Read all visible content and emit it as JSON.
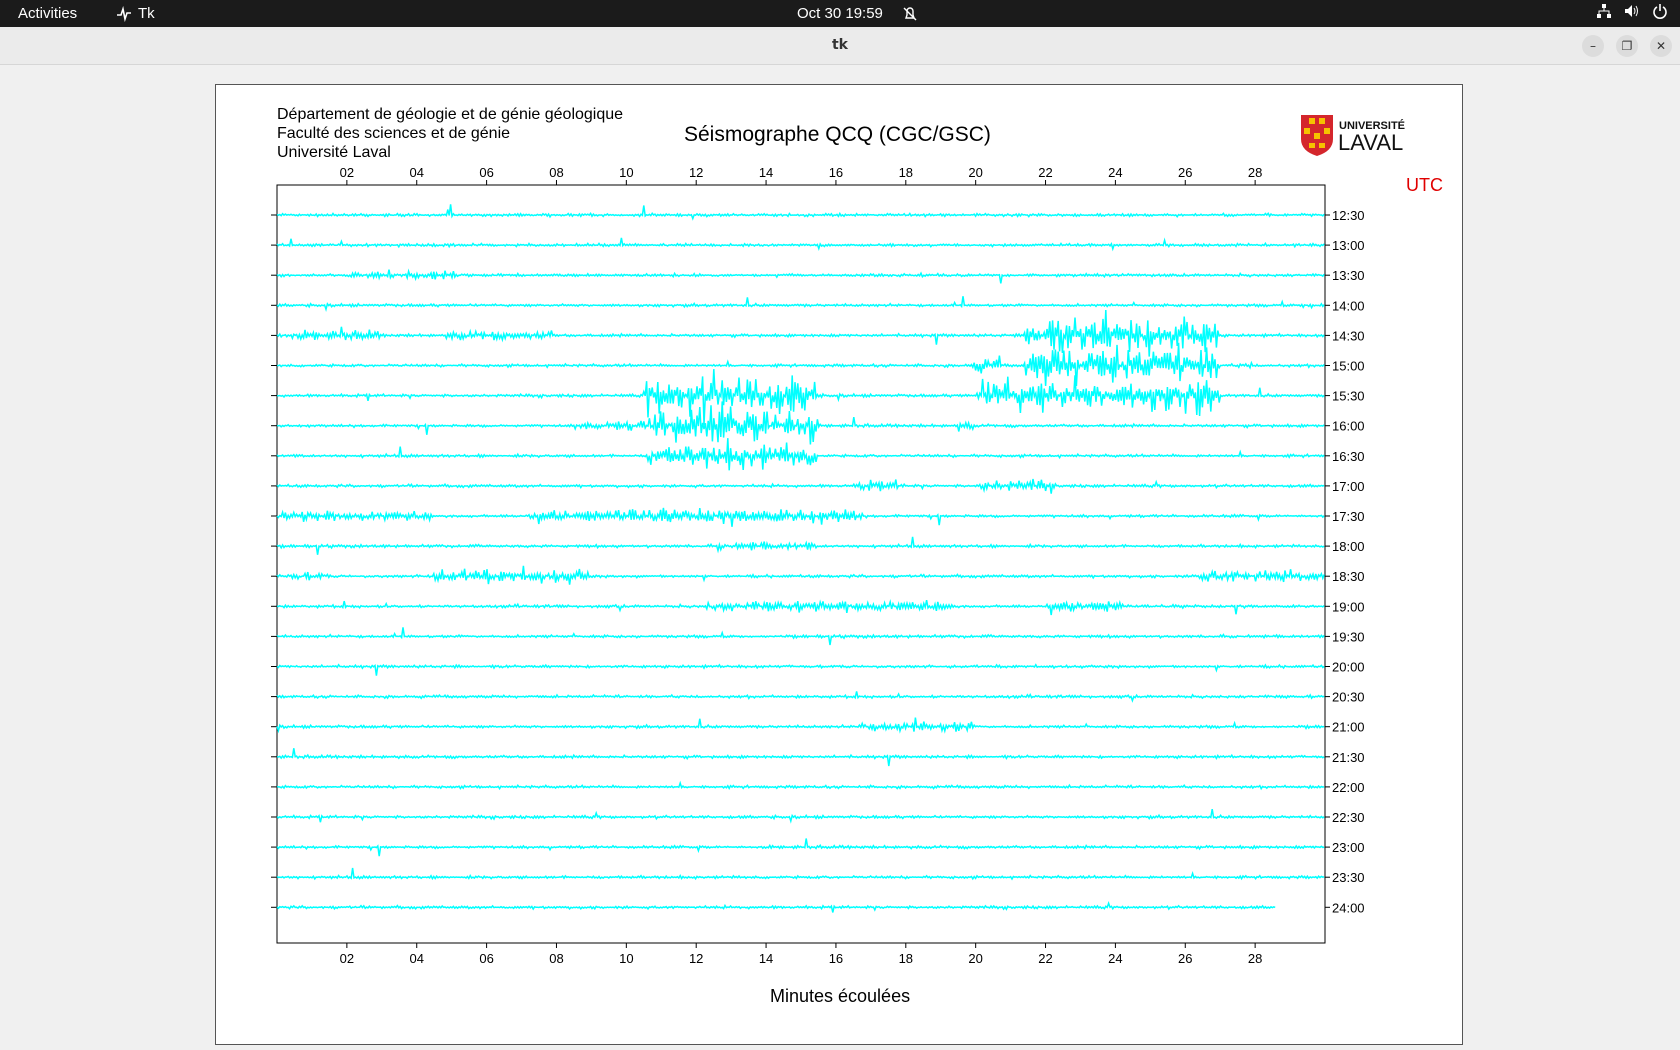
{
  "topbar": {
    "activities": "Activities",
    "app_name": "Tk",
    "datetime": "Oct 30  19:59"
  },
  "window": {
    "title": "tk"
  },
  "seismogram": {
    "header_lines": [
      "Département de géologie et de génie géologique",
      "Faculté des sciences et de génie",
      "Université Laval"
    ],
    "title": "Séismographe QCQ (CGC/GSC)",
    "logo_text": [
      "UNIVERSITÉ",
      "LAVAL"
    ],
    "timezone_label": "UTC",
    "xlabel": "Minutes écoulées",
    "colors": {
      "trace": "#00ffff",
      "utc_label": "#e00000",
      "axes": "#000000"
    }
  },
  "chart_data": {
    "type": "line",
    "x_range_minutes": [
      0,
      30
    ],
    "x_ticks": [
      "02",
      "04",
      "06",
      "08",
      "10",
      "12",
      "14",
      "16",
      "18",
      "20",
      "22",
      "24",
      "26",
      "28"
    ],
    "y_labels": [
      "12:30",
      "13:00",
      "13:30",
      "14:00",
      "14:30",
      "15:00",
      "15:30",
      "16:00",
      "16:30",
      "17:00",
      "17:30",
      "18:00",
      "18:30",
      "19:00",
      "19:30",
      "20:00",
      "20:30",
      "21:00",
      "21:30",
      "22:00",
      "22:30",
      "23:00",
      "23:30",
      "24:00"
    ],
    "trace_color": "#00ffff",
    "activity_bursts": [
      {
        "row": "13:30",
        "start_min": 1.9,
        "end_min": 5.2,
        "amplitude": 0.35
      },
      {
        "row": "14:00",
        "start_min": 29.3,
        "end_min": 30.0,
        "amplitude": 0.3
      },
      {
        "row": "14:30",
        "start_min": 0.0,
        "end_min": 3.0,
        "amplitude": 0.35
      },
      {
        "row": "14:30",
        "start_min": 4.8,
        "end_min": 8.0,
        "amplitude": 0.35
      },
      {
        "row": "14:30",
        "start_min": 21.4,
        "end_min": 27.0,
        "amplitude": 1.6
      },
      {
        "row": "15:00",
        "start_min": 19.8,
        "end_min": 20.8,
        "amplitude": 0.6
      },
      {
        "row": "15:00",
        "start_min": 21.4,
        "end_min": 27.0,
        "amplitude": 1.6
      },
      {
        "row": "15:00",
        "start_min": 27.5,
        "end_min": 28.0,
        "amplitude": 0.3
      },
      {
        "row": "15:30",
        "start_min": 10.5,
        "end_min": 15.5,
        "amplitude": 1.6
      },
      {
        "row": "15:30",
        "start_min": 20.0,
        "end_min": 27.0,
        "amplitude": 1.4
      },
      {
        "row": "16:00",
        "start_min": 8.5,
        "end_min": 10.6,
        "amplitude": 0.4
      },
      {
        "row": "16:00",
        "start_min": 10.6,
        "end_min": 15.5,
        "amplitude": 1.6
      },
      {
        "row": "16:00",
        "start_min": 19.4,
        "end_min": 20.0,
        "amplitude": 0.35
      },
      {
        "row": "16:30",
        "start_min": 10.6,
        "end_min": 15.5,
        "amplitude": 1.0
      },
      {
        "row": "17:00",
        "start_min": 16.5,
        "end_min": 18.0,
        "amplitude": 0.4
      },
      {
        "row": "17:00",
        "start_min": 20.0,
        "end_min": 22.3,
        "amplitude": 0.45
      },
      {
        "row": "17:30",
        "start_min": 0.0,
        "end_min": 4.5,
        "amplitude": 0.35
      },
      {
        "row": "17:30",
        "start_min": 7.2,
        "end_min": 16.8,
        "amplitude": 0.6
      },
      {
        "row": "18:00",
        "start_min": 12.5,
        "end_min": 15.5,
        "amplitude": 0.3
      },
      {
        "row": "18:30",
        "start_min": 0.0,
        "end_min": 1.5,
        "amplitude": 0.3
      },
      {
        "row": "18:30",
        "start_min": 4.2,
        "end_min": 9.0,
        "amplitude": 0.55
      },
      {
        "row": "18:30",
        "start_min": 26.2,
        "end_min": 30.0,
        "amplitude": 0.5
      },
      {
        "row": "19:00",
        "start_min": 12.2,
        "end_min": 19.5,
        "amplitude": 0.4
      },
      {
        "row": "19:00",
        "start_min": 22.0,
        "end_min": 24.3,
        "amplitude": 0.6
      },
      {
        "row": "21:00",
        "start_min": 16.6,
        "end_min": 20.0,
        "amplitude": 0.45
      }
    ]
  }
}
